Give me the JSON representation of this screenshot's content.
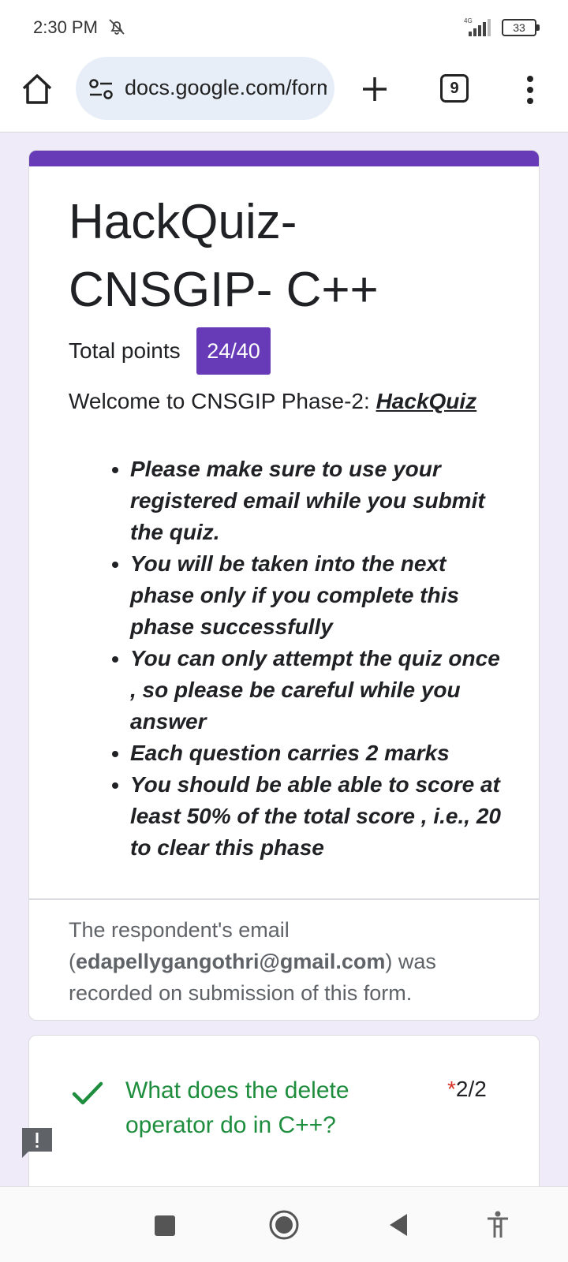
{
  "status_bar": {
    "time": "2:30 PM",
    "battery": "33",
    "network": "4G"
  },
  "browser": {
    "url": "docs.google.com/form",
    "tab_count": "9"
  },
  "form": {
    "title": "HackQuiz- CNSGIP- C++",
    "points_label": "Total points",
    "points_value": "24/40",
    "welcome_prefix": "Welcome to CNSGIP Phase-2: ",
    "welcome_link": "HackQuiz",
    "rules": [
      "Please make sure to use your registered email while you submit the quiz.",
      "You will be taken into the next phase only if you complete this phase successfully",
      "You can only attempt the quiz once , so please be careful while you answer",
      "Each question carries 2 marks",
      "You should be able able to score at least 50% of the total score , i.e., 20 to clear this phase"
    ],
    "email_note_prefix": "The respondent's email (",
    "email": "edapellygangothri@gmail.com",
    "email_note_suffix": ") was recorded on submission of this form."
  },
  "question": {
    "text": "What does the delete operator do in C++?",
    "required_mark": "*",
    "score": "2/2"
  },
  "colors": {
    "accent": "#673ab7",
    "correct": "#1e8e3e",
    "required": "#d93025"
  },
  "icons": {
    "home": "home-icon",
    "site_info": "site-settings-icon",
    "new_tab": "plus-icon",
    "menu": "more-vert-icon",
    "correct": "checkmark-icon",
    "feedback": "feedback-icon"
  }
}
